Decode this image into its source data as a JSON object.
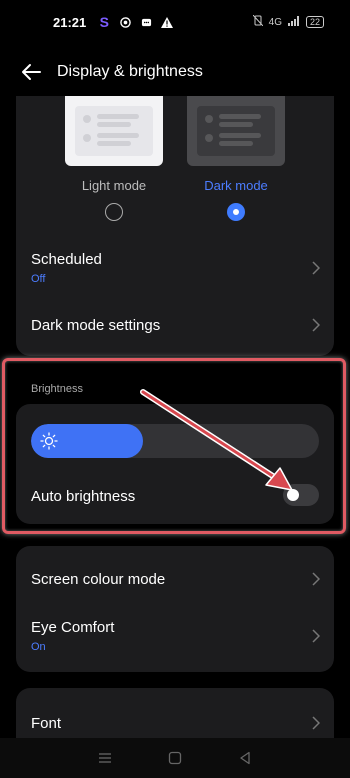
{
  "status_bar": {
    "time": "21:21",
    "network": "4G",
    "battery": "22"
  },
  "header": {
    "title": "Display & brightness"
  },
  "theme": {
    "light_label": "Light mode",
    "dark_label": "Dark mode",
    "selected": "Dark mode"
  },
  "scheduled": {
    "title": "Scheduled",
    "value": "Off"
  },
  "dark_mode_settings": {
    "title": "Dark mode settings"
  },
  "brightness": {
    "section_label": "Brightness",
    "level": 0.39,
    "auto_label": "Auto brightness",
    "auto_enabled": false
  },
  "screen_colour_mode": {
    "title": "Screen colour mode"
  },
  "eye_comfort": {
    "title": "Eye Comfort",
    "value": "On"
  },
  "font": {
    "title": "Font"
  },
  "colors": {
    "accent": "#3f72f5",
    "highlight": "#e05b63",
    "background": "#000000",
    "card": "#1c1c1e"
  }
}
